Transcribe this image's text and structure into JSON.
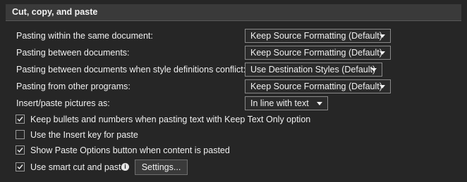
{
  "section": {
    "title": "Cut, copy, and paste"
  },
  "rows": [
    {
      "label": "Pasting within the same document:",
      "value": "Keep Source Formatting (Default)"
    },
    {
      "label": "Pasting between documents:",
      "value": "Keep Source Formatting (Default)"
    },
    {
      "label": "Pasting between documents when style definitions conflict:",
      "value": "Use Destination Styles (Default)"
    },
    {
      "label": "Pasting from other programs:",
      "value": "Keep Source Formatting (Default)"
    },
    {
      "label": "Insert/paste pictures as:",
      "value": "In line with text"
    }
  ],
  "checkboxes": [
    {
      "label": "Keep bullets and numbers when pasting text with Keep Text Only option",
      "checked": true
    },
    {
      "label": "Use the Insert key for paste",
      "checked": false
    },
    {
      "label": "Show Paste Options button when content is pasted",
      "checked": true
    },
    {
      "label": "Use smart cut and paste",
      "checked": true
    }
  ],
  "settings_button": {
    "label": "Settings..."
  },
  "icons": {
    "info": "info-icon",
    "dropdown": "chevron-down-icon",
    "check": "checkmark-icon"
  },
  "colors": {
    "background": "#262626",
    "header": "#3a3a3a",
    "text": "#f0f0f0",
    "border": "#8a8a8a"
  }
}
